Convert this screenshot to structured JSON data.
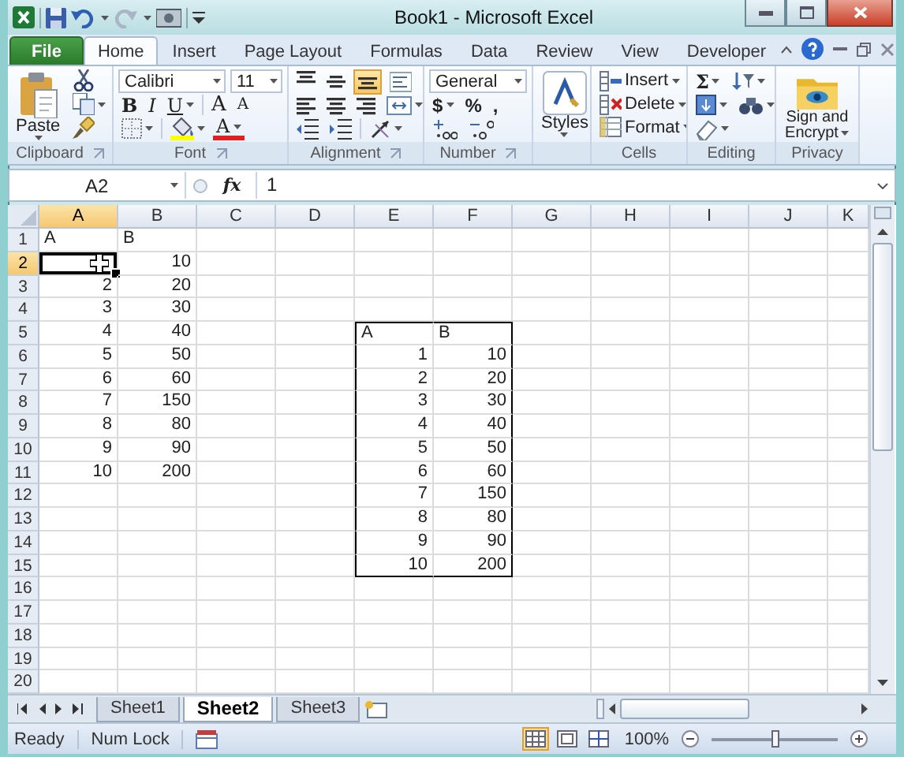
{
  "window": {
    "title": "Book1 - Microsoft Excel"
  },
  "tabs": [
    {
      "label": "File",
      "kind": "file",
      "selected": false
    },
    {
      "label": "Home",
      "kind": "tab",
      "selected": true
    },
    {
      "label": "Insert",
      "kind": "tab",
      "selected": false
    },
    {
      "label": "Page Layout",
      "kind": "tab",
      "selected": false
    },
    {
      "label": "Formulas",
      "kind": "tab",
      "selected": false
    },
    {
      "label": "Data",
      "kind": "tab",
      "selected": false
    },
    {
      "label": "Review",
      "kind": "tab",
      "selected": false
    },
    {
      "label": "View",
      "kind": "tab",
      "selected": false
    },
    {
      "label": "Developer",
      "kind": "tab",
      "selected": false
    }
  ],
  "ribbon": [
    {
      "kind": "clipboard",
      "label": "Clipboard",
      "button": "Paste",
      "launcher": true
    },
    {
      "kind": "font",
      "label": "Font",
      "launcher": true,
      "font_name": "Calibri",
      "font_size": "11",
      "styles": [
        "B",
        "I",
        "U"
      ],
      "grow": "A",
      "shrink": "A",
      "color_letter": "A"
    },
    {
      "kind": "alignment",
      "label": "Alignment",
      "launcher": true,
      "vertical": [
        {
          "kind": "top",
          "selected": false
        },
        {
          "kind": "middle",
          "selected": false
        },
        {
          "kind": "bottom",
          "selected": true
        }
      ]
    },
    {
      "kind": "number",
      "label": "Number",
      "launcher": true,
      "format": "General",
      "symbols": [
        "$",
        "%",
        ","
      ]
    },
    {
      "kind": "styles",
      "button": "Styles"
    },
    {
      "kind": "cells",
      "label": "Cells",
      "buttons": [
        "Insert",
        "Delete",
        "Format"
      ]
    },
    {
      "kind": "editing",
      "label": "Editing",
      "sum": "Σ"
    },
    {
      "kind": "privacy",
      "label": "Privacy",
      "button": "Sign and Encrypt"
    }
  ],
  "formula_bar": {
    "name_box": "A2",
    "function_label": "fx",
    "formula": "1"
  },
  "sheet": {
    "columns": [
      {
        "label": "A",
        "selected": true
      },
      {
        "label": "B",
        "selected": false
      },
      {
        "label": "C",
        "selected": false
      },
      {
        "label": "D",
        "selected": false
      },
      {
        "label": "E",
        "selected": false
      },
      {
        "label": "F",
        "selected": false
      },
      {
        "label": "G",
        "selected": false
      },
      {
        "label": "H",
        "selected": false
      },
      {
        "label": "I",
        "selected": false
      },
      {
        "label": "J",
        "selected": false
      },
      {
        "label": "K",
        "selected": false
      }
    ],
    "rows": [
      {
        "header": "1",
        "selected": false,
        "cells": [
          {
            "text": "A",
            "kind": "text"
          },
          {
            "text": "B",
            "kind": "text"
          }
        ]
      },
      {
        "header": "2",
        "selected": true,
        "cells": [
          {
            "kind": "empty"
          },
          {
            "text": "10",
            "kind": "number"
          }
        ]
      },
      {
        "header": "3",
        "selected": false,
        "cells": [
          {
            "text": "2",
            "kind": "number"
          },
          {
            "text": "20",
            "kind": "number"
          }
        ]
      },
      {
        "header": "4",
        "selected": false,
        "cells": [
          {
            "text": "3",
            "kind": "number"
          },
          {
            "text": "30",
            "kind": "number"
          }
        ]
      },
      {
        "header": "5",
        "selected": false,
        "cells": [
          {
            "text": "4",
            "kind": "number"
          },
          {
            "text": "40",
            "kind": "number"
          },
          {
            "kind": "empty"
          },
          {
            "kind": "empty"
          },
          {
            "text": "A",
            "kind": "text",
            "outlined": true
          },
          {
            "text": "B",
            "kind": "text",
            "outlined": true
          }
        ]
      },
      {
        "header": "6",
        "selected": false,
        "cells": [
          {
            "text": "5",
            "kind": "number"
          },
          {
            "text": "50",
            "kind": "number"
          },
          {
            "kind": "empty"
          },
          {
            "kind": "empty"
          },
          {
            "text": "1",
            "kind": "number",
            "outlined": true
          },
          {
            "text": "10",
            "kind": "number",
            "outlined": true
          }
        ]
      },
      {
        "header": "7",
        "selected": false,
        "cells": [
          {
            "text": "6",
            "kind": "number"
          },
          {
            "text": "60",
            "kind": "number"
          },
          {
            "kind": "empty"
          },
          {
            "kind": "empty"
          },
          {
            "text": "2",
            "kind": "number",
            "outlined": true
          },
          {
            "text": "20",
            "kind": "number",
            "outlined": true
          }
        ]
      },
      {
        "header": "8",
        "selected": false,
        "cells": [
          {
            "text": "7",
            "kind": "number"
          },
          {
            "text": "150",
            "kind": "number"
          },
          {
            "kind": "empty"
          },
          {
            "kind": "empty"
          },
          {
            "text": "3",
            "kind": "number",
            "outlined": true
          },
          {
            "text": "30",
            "kind": "number",
            "outlined": true
          }
        ]
      },
      {
        "header": "9",
        "selected": false,
        "cells": [
          {
            "text": "8",
            "kind": "number"
          },
          {
            "text": "80",
            "kind": "number"
          },
          {
            "kind": "empty"
          },
          {
            "kind": "empty"
          },
          {
            "text": "4",
            "kind": "number",
            "outlined": true
          },
          {
            "text": "40",
            "kind": "number",
            "outlined": true
          }
        ]
      },
      {
        "header": "10",
        "selected": false,
        "cells": [
          {
            "text": "9",
            "kind": "number"
          },
          {
            "text": "90",
            "kind": "number"
          },
          {
            "kind": "empty"
          },
          {
            "kind": "empty"
          },
          {
            "text": "5",
            "kind": "number",
            "outlined": true
          },
          {
            "text": "50",
            "kind": "number",
            "outlined": true
          }
        ]
      },
      {
        "header": "11",
        "selected": false,
        "cells": [
          {
            "text": "10",
            "kind": "number"
          },
          {
            "text": "200",
            "kind": "number"
          },
          {
            "kind": "empty"
          },
          {
            "kind": "empty"
          },
          {
            "text": "6",
            "kind": "number",
            "outlined": true
          },
          {
            "text": "60",
            "kind": "number",
            "outlined": true
          }
        ]
      },
      {
        "header": "12",
        "selected": false,
        "cells": [
          {
            "kind": "empty"
          },
          {
            "kind": "empty"
          },
          {
            "kind": "empty"
          },
          {
            "kind": "empty"
          },
          {
            "text": "7",
            "kind": "number",
            "outlined": true
          },
          {
            "text": "150",
            "kind": "number",
            "outlined": true
          }
        ]
      },
      {
        "header": "13",
        "selected": false,
        "cells": [
          {
            "kind": "empty"
          },
          {
            "kind": "empty"
          },
          {
            "kind": "empty"
          },
          {
            "kind": "empty"
          },
          {
            "text": "8",
            "kind": "number",
            "outlined": true
          },
          {
            "text": "80",
            "kind": "number",
            "outlined": true
          }
        ]
      },
      {
        "header": "14",
        "selected": false,
        "cells": [
          {
            "kind": "empty"
          },
          {
            "kind": "empty"
          },
          {
            "kind": "empty"
          },
          {
            "kind": "empty"
          },
          {
            "text": "9",
            "kind": "number",
            "outlined": true
          },
          {
            "text": "90",
            "kind": "number",
            "outlined": true
          }
        ]
      },
      {
        "header": "15",
        "selected": false,
        "cells": [
          {
            "kind": "empty"
          },
          {
            "kind": "empty"
          },
          {
            "kind": "empty"
          },
          {
            "kind": "empty"
          },
          {
            "text": "10",
            "kind": "number",
            "outlined": true
          },
          {
            "text": "200",
            "kind": "number",
            "outlined": true
          }
        ]
      },
      {
        "header": "16",
        "selected": false
      },
      {
        "header": "17",
        "selected": false
      },
      {
        "header": "18",
        "selected": false
      },
      {
        "header": "19",
        "selected": false
      },
      {
        "header": "20",
        "selected": false
      }
    ]
  },
  "sheet_tabs": [
    {
      "label": "Sheet1",
      "selected": false
    },
    {
      "label": "Sheet2",
      "selected": true
    },
    {
      "label": "Sheet3",
      "selected": false
    }
  ],
  "status_bar": {
    "items": [
      "Ready",
      "Num Lock"
    ],
    "views": [
      {
        "kind": "normal",
        "selected": true
      },
      {
        "kind": "page_layout",
        "selected": false
      },
      {
        "kind": "page_break",
        "selected": false
      }
    ],
    "zoom": {
      "label": "100%",
      "level": 0.5
    }
  }
}
